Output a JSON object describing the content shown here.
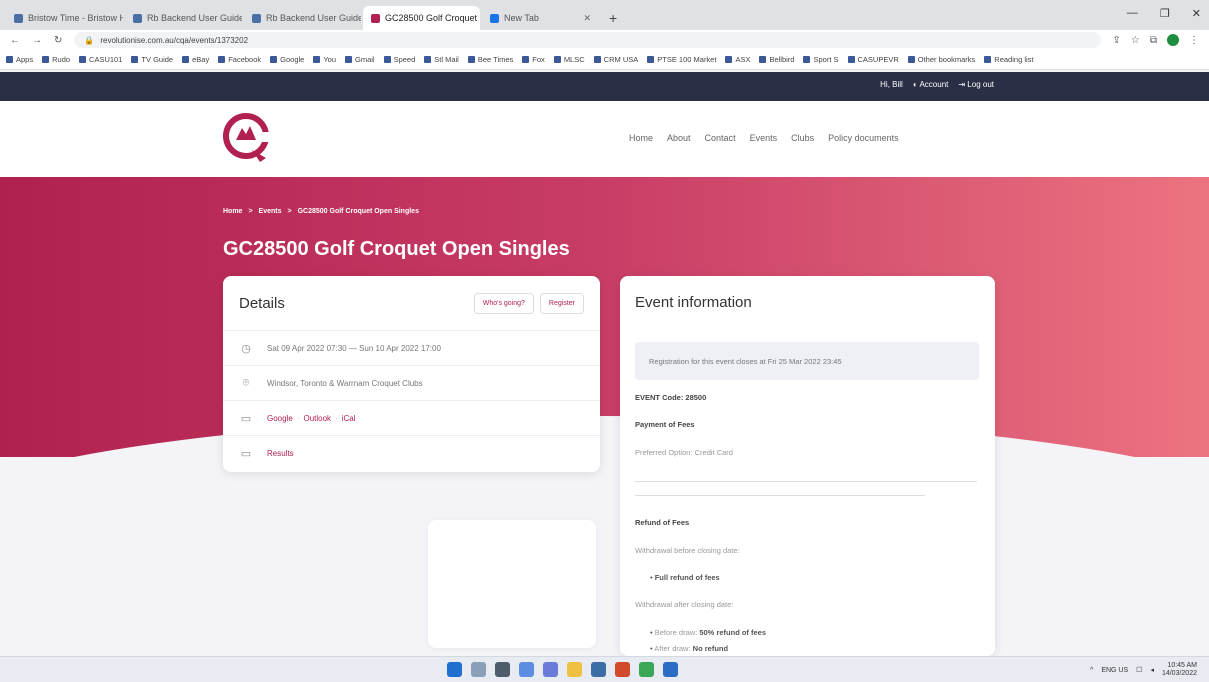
{
  "browser": {
    "tabs": [
      {
        "label": "Bristow Time - Bristow Hern...",
        "active": false
      },
      {
        "label": "Rb Backend User Guide - Croquet...",
        "active": false
      },
      {
        "label": "Rb Backend User Guide - Croquet...",
        "active": false
      },
      {
        "label": "GC28500 Golf Croquet Open Si...",
        "active": true
      },
      {
        "label": "New Tab",
        "active": false
      }
    ],
    "new_tab": "+",
    "window_controls": [
      "—",
      "❐",
      "✕"
    ],
    "url": "revolutionise.com.au/cqa/events/1373202",
    "bookmarks": [
      "Apps",
      "Rudo",
      "CASU101",
      "TV Guide",
      "eBay",
      "Facebook",
      "Google",
      "You",
      "Gmail",
      "Speed",
      "Stl Mail",
      "Bee Times",
      "Fox",
      "MLSC",
      "CRM USA",
      "PTSE 100 Market",
      "ASX",
      "Bellbird",
      "Sport S",
      "CASUPEVR",
      "Other bookmarks",
      "Reading list"
    ]
  },
  "site": {
    "topbar": {
      "greeting": "Hi, Bill",
      "account": "Account",
      "logout": "Log out"
    },
    "nav": [
      "Home",
      "About",
      "Contact",
      "Events",
      "Clubs",
      "Policy documents"
    ],
    "breadcrumb": {
      "home": "Home",
      "sep": ">",
      "events": "Events",
      "current": "GC28500 Golf Croquet Open Singles"
    },
    "title": "GC28500 Golf Croquet Open Singles",
    "details": {
      "heading": "Details",
      "whos_going": "Who's going?",
      "register": "Register",
      "dates": "Sat 09 Apr 2022 07:30 — Sun 10 Apr 2022 17:00",
      "venue": "Windsor, Toronto & Warrnam Croquet Clubs",
      "cal_google": "Google",
      "cal_outlook": "Outlook",
      "cal_ical": "iCal",
      "results": "Results"
    },
    "event_info": {
      "heading": "Event information",
      "notice": "Registration for this event closes at Fri 25 Mar 2022 23:45",
      "event_code": "EVENT Code: 28500",
      "payment_heading": "Payment of Fees",
      "payment_option": "Preferred Option: Credit Card",
      "refund_heading": "Refund of Fees",
      "before_closing": "Withdrawal before closing date:",
      "full_refund": "Full refund of fees",
      "after_closing": "Withdrawal after closing date:",
      "before_draw_label": "Before draw:",
      "before_draw_value": "50% refund of fees",
      "after_draw_label": "After draw:",
      "after_draw_value": "No refund"
    }
  },
  "taskbar": {
    "lang": "ENG US",
    "time": "10:45 AM",
    "date": "14/03/2022"
  },
  "colors": {
    "brand": "#b0214f",
    "hero_end": "#ec7380",
    "topbar": "#2a2f45"
  }
}
